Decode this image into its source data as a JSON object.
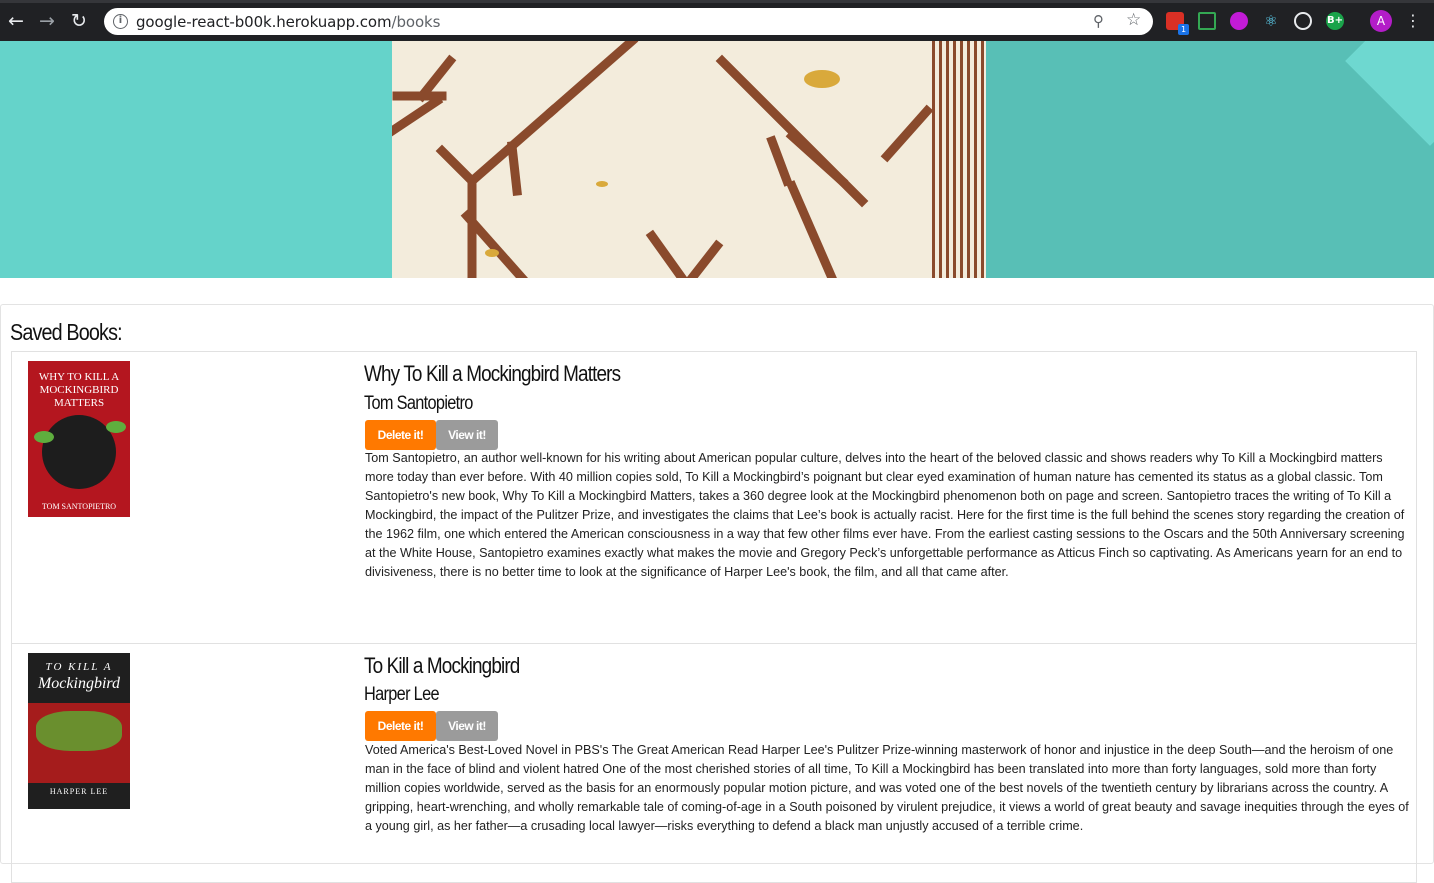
{
  "browser": {
    "url_host": "google-react-b00k.herokuapp.com",
    "url_path": "/books",
    "ext_badge": "1",
    "ext_bplus": "B+",
    "profile_initial": "A",
    "icons": [
      "back-icon",
      "forward-icon",
      "reload-icon",
      "info-icon",
      "zoom-icon",
      "star-icon",
      "extension-icon",
      "screenshot-icon",
      "eye-icon",
      "react-icon",
      "target-icon",
      "bplus-icon",
      "profile-icon",
      "menu-icon"
    ]
  },
  "page": {
    "section_title": "Saved Books:"
  },
  "books": [
    {
      "title": "Why To Kill a Mockingbird Matters",
      "author": "Tom Santopietro",
      "delete_label": "Delete it!",
      "view_label": "View it!",
      "cover_title": "WHY TO KILL A MOCKINGBIRD MATTERS",
      "cover_author": "TOM SANTOPIETRO",
      "description": "Tom Santopietro, an author well-known for his writing about American popular culture, delves into the heart of the beloved classic and shows readers why To Kill a Mockingbird matters more today than ever before. With 40 million copies sold, To Kill a Mockingbird’s poignant but clear eyed examination of human nature has cemented its status as a global classic. Tom Santopietro's new book, Why To Kill a Mockingbird Matters, takes a 360 degree look at the Mockingbird phenomenon both on page and screen. Santopietro traces the writing of To Kill a Mockingbird, the impact of the Pulitzer Prize, and investigates the claims that Lee’s book is actually racist. Here for the first time is the full behind the scenes story regarding the creation of the 1962 film, one which entered the American consciousness in a way that few other films ever have. From the earliest casting sessions to the Oscars and the 50th Anniversary screening at the White House, Santopietro examines exactly what makes the movie and Gregory Peck’s unforgettable performance as Atticus Finch so captivating. As Americans yearn for an end to divisiveness, there is no better time to look at the significance of Harper Lee's book, the film, and all that came after."
    },
    {
      "title": "To Kill a Mockingbird",
      "author": "Harper Lee",
      "delete_label": "Delete it!",
      "view_label": "View it!",
      "cover_title": "TO KILL A",
      "cover_title2": "Mockingbird",
      "cover_author": "HARPER LEE",
      "description": "Voted America's Best-Loved Novel in PBS's The Great American Read Harper Lee's Pulitzer Prize-winning masterwork of honor and injustice in the deep South—and the heroism of one man in the face of blind and violent hatred One of the most cherished stories of all time, To Kill a Mockingbird has been translated into more than forty languages, sold more than forty million copies worldwide, served as the basis for an enormously popular motion picture, and was voted one of the best novels of the twentieth century by librarians across the country. A gripping, heart-wrenching, and wholly remarkable tale of coming-of-age in a South poisoned by virulent prejudice, it views a world of great beauty and savage inequities through the eyes of a young girl, as her father—a crusading local lawyer—risks everything to defend a black man unjustly accused of a terrible crime."
    }
  ]
}
